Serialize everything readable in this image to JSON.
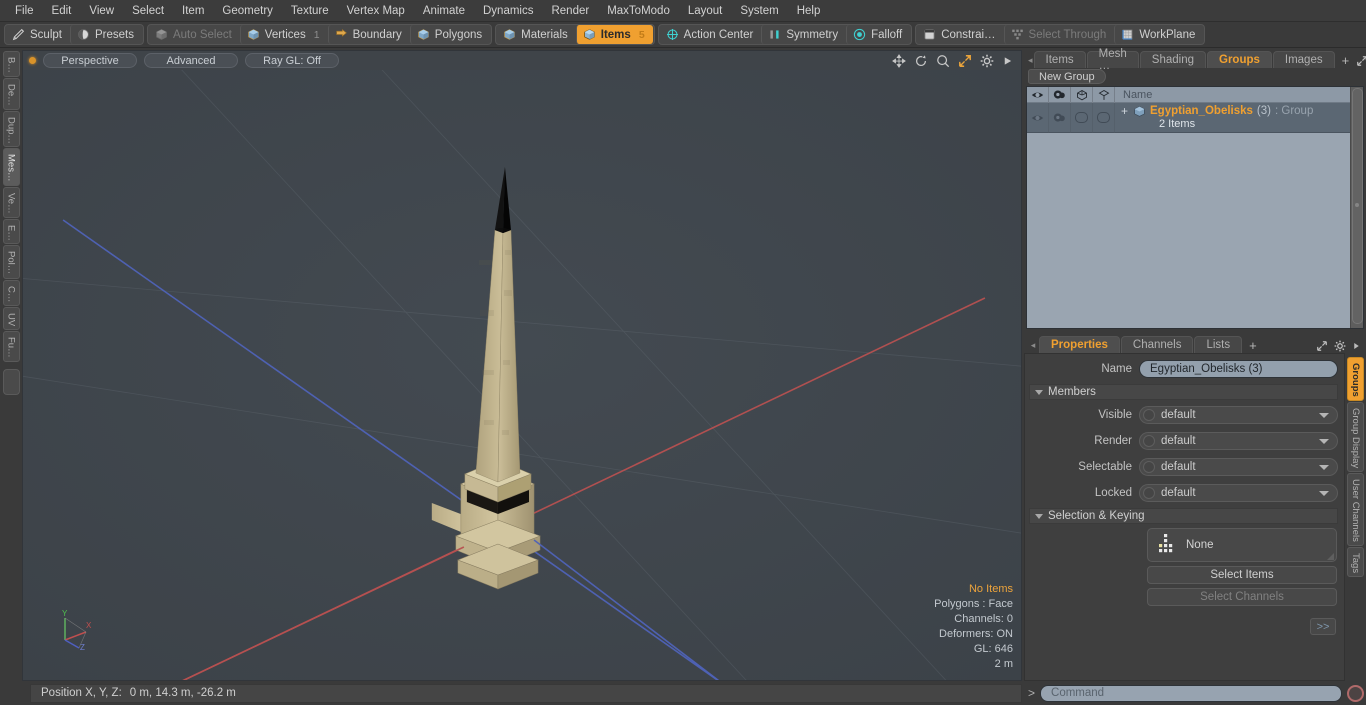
{
  "menubar": {
    "items": [
      {
        "label": "File"
      },
      {
        "label": "Edit"
      },
      {
        "label": "View"
      },
      {
        "label": "Select"
      },
      {
        "label": "Item"
      },
      {
        "label": "Geometry"
      },
      {
        "label": "Texture"
      },
      {
        "label": "Vertex Map"
      },
      {
        "label": "Animate"
      },
      {
        "label": "Dynamics"
      },
      {
        "label": "Render"
      },
      {
        "label": "MaxToModo"
      },
      {
        "label": "Layout"
      },
      {
        "label": "System"
      },
      {
        "label": "Help"
      }
    ]
  },
  "toolbar": {
    "group1": [
      {
        "label": "Sculpt",
        "icon": "pencil-icon",
        "state": "normal",
        "count": ""
      },
      {
        "label": "Presets",
        "icon": "sphere-icon",
        "state": "normal",
        "count": ""
      }
    ],
    "group2": [
      {
        "label": "Auto Select",
        "icon": "cube-grey-icon",
        "state": "disabled",
        "count": ""
      },
      {
        "label": "Vertices",
        "icon": "cube-blue-icon",
        "state": "normal",
        "count": "1"
      },
      {
        "label": "Boundary",
        "icon": "boundary-icon",
        "state": "normal",
        "count": ""
      },
      {
        "label": "Polygons",
        "icon": "cube-blue-icon",
        "state": "normal",
        "count": ""
      }
    ],
    "group3": [
      {
        "label": "Materials",
        "icon": "cube-blue-icon",
        "state": "normal",
        "count": ""
      },
      {
        "label": "Items",
        "icon": "cube-orange-icon",
        "state": "active",
        "count": "5"
      }
    ],
    "group4": [
      {
        "label": "Action Center",
        "icon": "crosshair-icon",
        "state": "normal",
        "count": ""
      },
      {
        "label": "Symmetry",
        "icon": "symmetry-icon",
        "state": "normal",
        "count": ""
      },
      {
        "label": "Falloff",
        "icon": "falloff-icon",
        "state": "normal",
        "count": ""
      }
    ],
    "group5": [
      {
        "label": "Constrai…",
        "icon": "constraint-icon",
        "state": "normal",
        "count": ""
      },
      {
        "label": "Select Through",
        "icon": "select-through-icon",
        "state": "disabled",
        "count": ""
      },
      {
        "label": "WorkPlane",
        "icon": "workplane-icon",
        "state": "normal",
        "count": ""
      }
    ]
  },
  "left_tabs": [
    {
      "label": "B…",
      "active": false
    },
    {
      "label": "De…",
      "active": false
    },
    {
      "label": "Dup…",
      "active": false
    },
    {
      "label": "Mes…",
      "active": true
    },
    {
      "label": "Ve…",
      "active": false
    },
    {
      "label": "E…",
      "active": false
    },
    {
      "label": "Pol…",
      "active": false
    },
    {
      "label": "C…",
      "active": false
    },
    {
      "label": "UV",
      "active": false
    },
    {
      "label": "Fu…",
      "active": false
    }
  ],
  "viewport": {
    "header": {
      "mode": "Perspective",
      "shading": "Advanced",
      "raygl": "Ray GL: Off",
      "icons": [
        "move-icon",
        "rotate-icon",
        "zoom-icon",
        "fit-icon",
        "gear-icon",
        "play-icon"
      ]
    },
    "stats": [
      {
        "text": "No Items",
        "highlight": true
      },
      {
        "text": "Polygons : Face",
        "highlight": false
      },
      {
        "text": "Channels: 0",
        "highlight": false
      },
      {
        "text": "Deformers: ON",
        "highlight": false
      },
      {
        "text": "GL: 646",
        "highlight": false
      },
      {
        "text": "2 m",
        "highlight": false
      }
    ],
    "gizmo": {
      "x": "X",
      "y": "Y",
      "z": "Z"
    },
    "model": "egyptian-obelisk"
  },
  "right_panel": {
    "tabs": [
      {
        "label": "Items",
        "active": false
      },
      {
        "label": "Mesh …",
        "active": false
      },
      {
        "label": "Shading",
        "active": false
      },
      {
        "label": "Groups",
        "active": true
      },
      {
        "label": "Images",
        "active": false
      }
    ],
    "tab_add": "+",
    "new_group_button": "New Group",
    "list": {
      "columns": [
        "eye-icon",
        "render-icon",
        "cube-icon",
        "lock-icon"
      ],
      "name_header": "Name",
      "rows": [
        {
          "expand": "+",
          "icon": "group-cube-icon",
          "title": "Egyptian_Obelisks",
          "count": "(3)",
          "type": ": Group",
          "subtitle": "2 Items"
        }
      ]
    }
  },
  "properties": {
    "tabs": [
      {
        "label": "Properties",
        "active": true
      },
      {
        "label": "Channels",
        "active": false
      },
      {
        "label": "Lists",
        "active": false
      }
    ],
    "tab_add": "+",
    "name_label": "Name",
    "name_value": "Egyptian_Obelisks (3)",
    "members_section": "Members",
    "members": [
      {
        "label": "Visible",
        "value": "default"
      },
      {
        "label": "Render",
        "value": "default"
      },
      {
        "label": "Selectable",
        "value": "default"
      },
      {
        "label": "Locked",
        "value": "default"
      }
    ],
    "selection_section": "Selection & Keying",
    "selection_none": "None",
    "select_items_button": "Select Items",
    "select_channels_button": "Select Channels",
    "expand_button": ">>"
  },
  "right_tabs": [
    {
      "label": "Groups",
      "active": true
    },
    {
      "label": "Group Display",
      "active": false
    },
    {
      "label": "User Channels",
      "active": false
    },
    {
      "label": "Tags",
      "active": false
    }
  ],
  "statusbar": {
    "position_label": "Position X, Y, Z:",
    "position_value": "0 m, 14.3 m, -26.2 m",
    "command_prompt": ">",
    "command_placeholder": "Command",
    "record_button": "record-icon"
  },
  "colors": {
    "accent": "#f0a030",
    "panel_bg": "#3a3a3a",
    "viewport_bg": "#3e444a",
    "list_bg": "#9aa5b1",
    "field_bg": "#93a0ad",
    "axis_x": "#c05050",
    "axis_y": "#50b050",
    "axis_z": "#5060c0"
  }
}
